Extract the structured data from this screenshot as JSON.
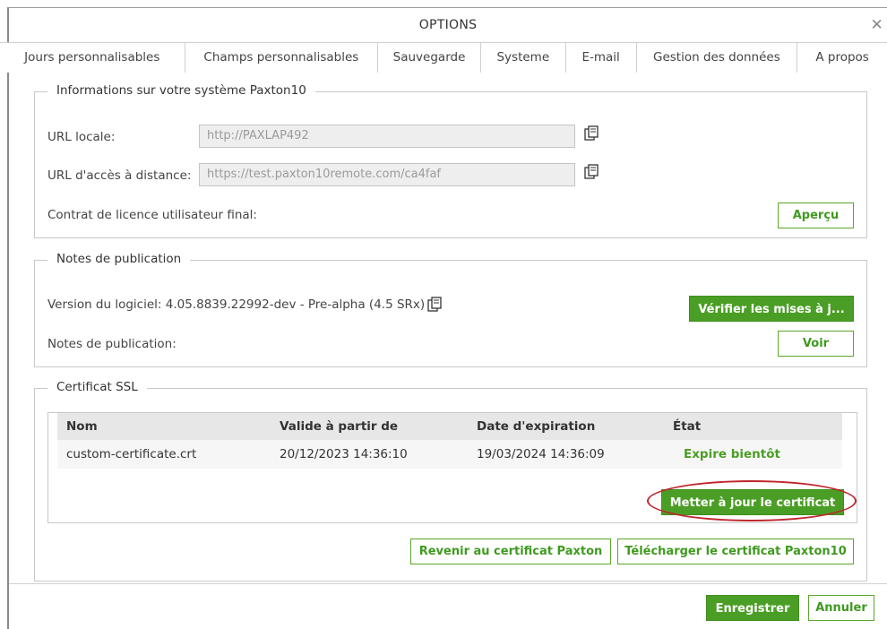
{
  "window": {
    "title": "OPTIONS",
    "close_glyph": "✕"
  },
  "tabs": [
    {
      "label": "Jours personnalisables"
    },
    {
      "label": "Champs personnalisables"
    },
    {
      "label": "Sauvegarde"
    },
    {
      "label": "Systeme"
    },
    {
      "label": "E-mail"
    },
    {
      "label": "Gestion des données"
    },
    {
      "label": "A propos",
      "active": true
    }
  ],
  "system_info": {
    "legend": "Informations sur votre système Paxton10",
    "local_url_label": "URL locale:",
    "local_url_value": "http://PAXLAP492",
    "remote_url_label": "URL d'accès à distance:",
    "remote_url_value": "https://test.paxton10remote.com/ca4faf",
    "license_label": "Contrat de licence utilisateur final:",
    "preview_button": "Aperçu",
    "copy_icon": "copy-icon"
  },
  "release_notes": {
    "legend": "Notes de publication",
    "version_text": "Version du logiciel: 4.05.8839.22992-dev - Pre-alpha (4.5 SRx)",
    "check_updates_button": "Vérifier les mises à j...",
    "notes_label": "Notes de publication:",
    "view_button": "Voir"
  },
  "ssl": {
    "legend": "Certificat SSL",
    "columns": [
      "Nom",
      "Valide à partir de",
      "Date d'expiration",
      "État"
    ],
    "rows": [
      [
        "custom-certificate.crt",
        "20/12/2023 14:36:10",
        "19/03/2024 14:36:09",
        "Expire bientôt"
      ]
    ],
    "update_button": "Metter à jour le certificat",
    "revert_button": "Revenir au certificat Paxton",
    "download_button": "Télécharger le certificat Paxton10"
  },
  "footer": {
    "save_button": "Enregistrer",
    "cancel_button": "Annuler"
  },
  "colors": {
    "accent_green": "#4b9e25",
    "highlight_red": "#c0262d"
  }
}
